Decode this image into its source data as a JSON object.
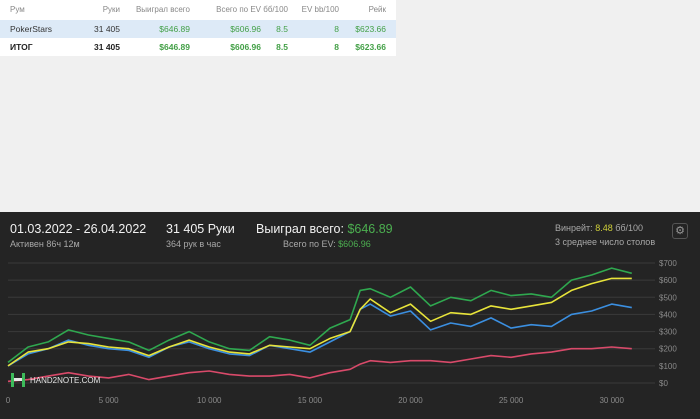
{
  "table": {
    "headers": [
      "Рум",
      "Руки",
      "Выиграл всего",
      "Всего по EV",
      "бб/100",
      "EV bb/100",
      "Рейк"
    ],
    "rows": [
      {
        "room": "PokerStars",
        "hands": "31 405",
        "won": "$646.89",
        "ev": "$606.96",
        "bb100": "8.5",
        "evbb100": "8",
        "rake": "$623.66"
      }
    ],
    "total": {
      "room": "ИТОГ",
      "hands": "31 405",
      "won": "$646.89",
      "ev": "$606.96",
      "bb100": "8.5",
      "evbb100": "8",
      "rake": "$623.66"
    }
  },
  "summary": {
    "date_range": "01.03.2022 - 26.04.2022",
    "active": "Активен 86ч 12м",
    "hands": "31 405 Руки",
    "hands_per_hour": "364 рук в час",
    "won_label": "Выиграл всего:",
    "won_value": "$646.89",
    "ev_label": "Всего по EV:",
    "ev_value": "$606.96",
    "winrate_label": "Винрейт:",
    "winrate_value": "8.48",
    "winrate_unit": "бб/100",
    "tables": "3 среднее число столов"
  },
  "logo": "HAND2NOTE.COM",
  "icons": {
    "settings": "gear-icon"
  },
  "chart_data": {
    "type": "line",
    "title": "",
    "xlabel": "",
    "ylabel": "",
    "xlim": [
      0,
      31405
    ],
    "ylim": [
      0,
      700
    ],
    "x_ticks": [
      0,
      5000,
      10000,
      15000,
      20000,
      25000,
      30000
    ],
    "x_tick_labels": [
      "0",
      "5 000",
      "10 000",
      "15 000",
      "20 000",
      "25 000",
      "30 000"
    ],
    "y_ticks": [
      0,
      100,
      200,
      300,
      400,
      500,
      600,
      700
    ],
    "y_tick_labels": [
      "$0",
      "$100",
      "$200",
      "$300",
      "$400",
      "$500",
      "$600",
      "$700"
    ],
    "grid": true,
    "colors": {
      "green": "#2fa84f",
      "yellow": "#e8e43a",
      "blue": "#3b8fe0",
      "red": "#d94a6a"
    },
    "x": [
      0,
      1000,
      2000,
      3000,
      4000,
      5000,
      6000,
      7000,
      8000,
      9000,
      10000,
      11000,
      12000,
      13000,
      14000,
      15000,
      16000,
      17000,
      17500,
      18000,
      19000,
      20000,
      21000,
      22000,
      23000,
      24000,
      25000,
      26000,
      27000,
      28000,
      29000,
      30000,
      31000
    ],
    "series": [
      {
        "values": [
          120,
          210,
          240,
          310,
          280,
          260,
          240,
          190,
          250,
          300,
          240,
          200,
          190,
          270,
          250,
          220,
          320,
          370,
          540,
          550,
          500,
          560,
          450,
          500,
          480,
          540,
          510,
          520,
          500,
          600,
          630,
          670,
          640
        ]
      },
      {
        "values": [
          100,
          180,
          200,
          240,
          230,
          210,
          200,
          160,
          210,
          250,
          210,
          180,
          170,
          220,
          210,
          200,
          260,
          300,
          430,
          490,
          410,
          460,
          360,
          410,
          400,
          450,
          430,
          450,
          470,
          540,
          580,
          610,
          610
        ]
      },
      {
        "values": [
          100,
          170,
          200,
          250,
          220,
          200,
          190,
          150,
          210,
          240,
          200,
          170,
          160,
          220,
          200,
          180,
          240,
          300,
          430,
          460,
          390,
          420,
          310,
          350,
          330,
          380,
          320,
          340,
          330,
          400,
          420,
          460,
          440
        ]
      },
      {
        "values": [
          10,
          20,
          40,
          60,
          40,
          30,
          50,
          20,
          40,
          60,
          70,
          50,
          40,
          40,
          50,
          30,
          60,
          80,
          110,
          130,
          120,
          130,
          130,
          120,
          140,
          160,
          150,
          170,
          180,
          200,
          200,
          210,
          200
        ]
      }
    ]
  }
}
